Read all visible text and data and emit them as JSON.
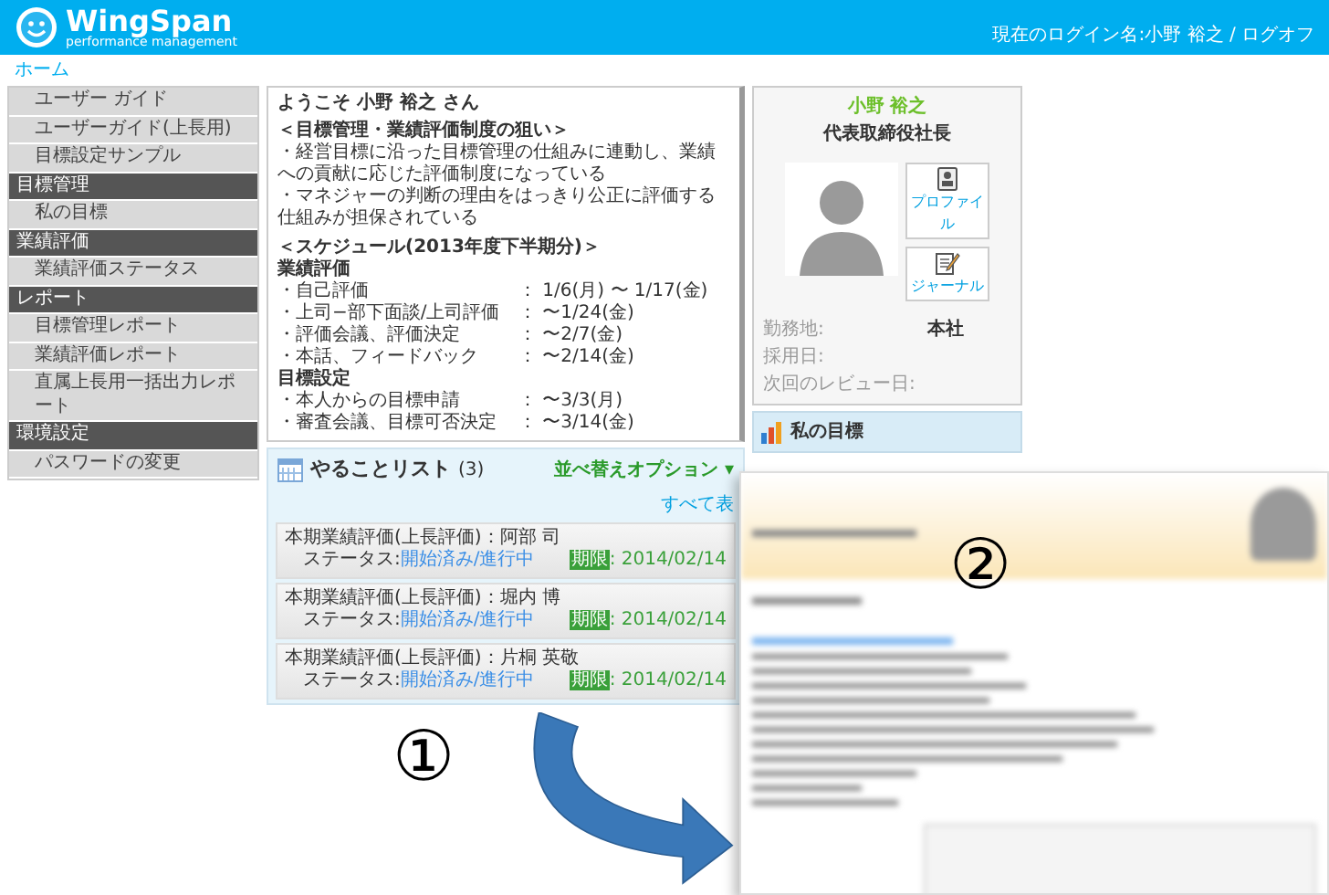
{
  "header": {
    "logo_title": "WingSpan",
    "logo_subtitle": "performance management",
    "login_label": "現在のログイン名:",
    "login_name": "小野 裕之",
    "separator": "/",
    "logoff": "ログオフ"
  },
  "breadcrumb": "ホーム",
  "sidebar": [
    {
      "kind": "item",
      "label": "ユーザー ガイド"
    },
    {
      "kind": "item",
      "label": "ユーザーガイド(上長用)"
    },
    {
      "kind": "item",
      "label": "目標設定サンプル"
    },
    {
      "kind": "section",
      "label": "目標管理"
    },
    {
      "kind": "item",
      "label": "私の目標"
    },
    {
      "kind": "section",
      "label": "業績評価"
    },
    {
      "kind": "item",
      "label": "業績評価ステータス"
    },
    {
      "kind": "section",
      "label": "レポート"
    },
    {
      "kind": "item",
      "label": "目標管理レポート"
    },
    {
      "kind": "item",
      "label": "業績評価レポート"
    },
    {
      "kind": "item",
      "label": "直属上長用一括出力レポート"
    },
    {
      "kind": "section",
      "label": "環境設定"
    },
    {
      "kind": "item",
      "label": "パスワードの変更"
    }
  ],
  "welcome": {
    "greeting": "ようこそ 小野 裕之 さん",
    "aim_title": "＜目標管理・業績評価制度の狙い＞",
    "aim_lines": [
      "・経営目標に沿った目標管理の仕組みに連動し、業績への貢献に応じた評価制度になっている",
      "・マネジャーの判断の理由をはっきり公正に評価する仕組みが担保されている"
    ],
    "schedule_title": "＜スケジュール(2013年度下半期分)＞",
    "groups": [
      {
        "heading": "業績評価",
        "rows": [
          {
            "task": "・自己評価",
            "date": "： 1/6(月) 〜 1/17(金)"
          },
          {
            "task": "・上司−部下面談/上司評価",
            "date": "： 〜1/24(金)"
          },
          {
            "task": "・評価会議、評価決定",
            "date": "： 〜2/7(金)"
          },
          {
            "task": "・本話、フィードバック",
            "date": "： 〜2/14(金)"
          }
        ]
      },
      {
        "heading": "目標設定",
        "rows": [
          {
            "task": "・本人からの目標申請",
            "date": "： 〜3/3(月)"
          },
          {
            "task": "・審査会議、目標可否決定",
            "date": "： 〜3/14(金)"
          }
        ]
      }
    ]
  },
  "todo": {
    "title": "やることリスト",
    "count": "(3)",
    "sort_option": "並べ替えオプション ▾",
    "show_all": "すべて表",
    "items": [
      {
        "title": "本期業績評価(上長評価)：阿部 司",
        "status_label": "ステータス:",
        "status": "開始済み/進行中",
        "due_label": "期限",
        "due": ": 2014/02/14"
      },
      {
        "title": "本期業績評価(上長評価)：堀内 博",
        "status_label": "ステータス:",
        "status": "開始済み/進行中",
        "due_label": "期限",
        "due": ": 2014/02/14"
      },
      {
        "title": "本期業績評価(上長評価)：片桐 英敬",
        "status_label": "ステータス:",
        "status": "開始済み/進行中",
        "due_label": "期限",
        "due": ": 2014/02/14"
      }
    ]
  },
  "profile": {
    "name": "小野 裕之",
    "role": "代表取締役社長",
    "buttons": [
      "プロファイル",
      "ジャーナル"
    ],
    "fields": [
      {
        "label": "勤務地:",
        "value": "本社"
      },
      {
        "label": "採用日:"
      },
      {
        "label": "次回のレビュー日:"
      }
    ]
  },
  "goals_panel": {
    "title": "私の目標"
  },
  "markers": [
    "①",
    "②"
  ]
}
